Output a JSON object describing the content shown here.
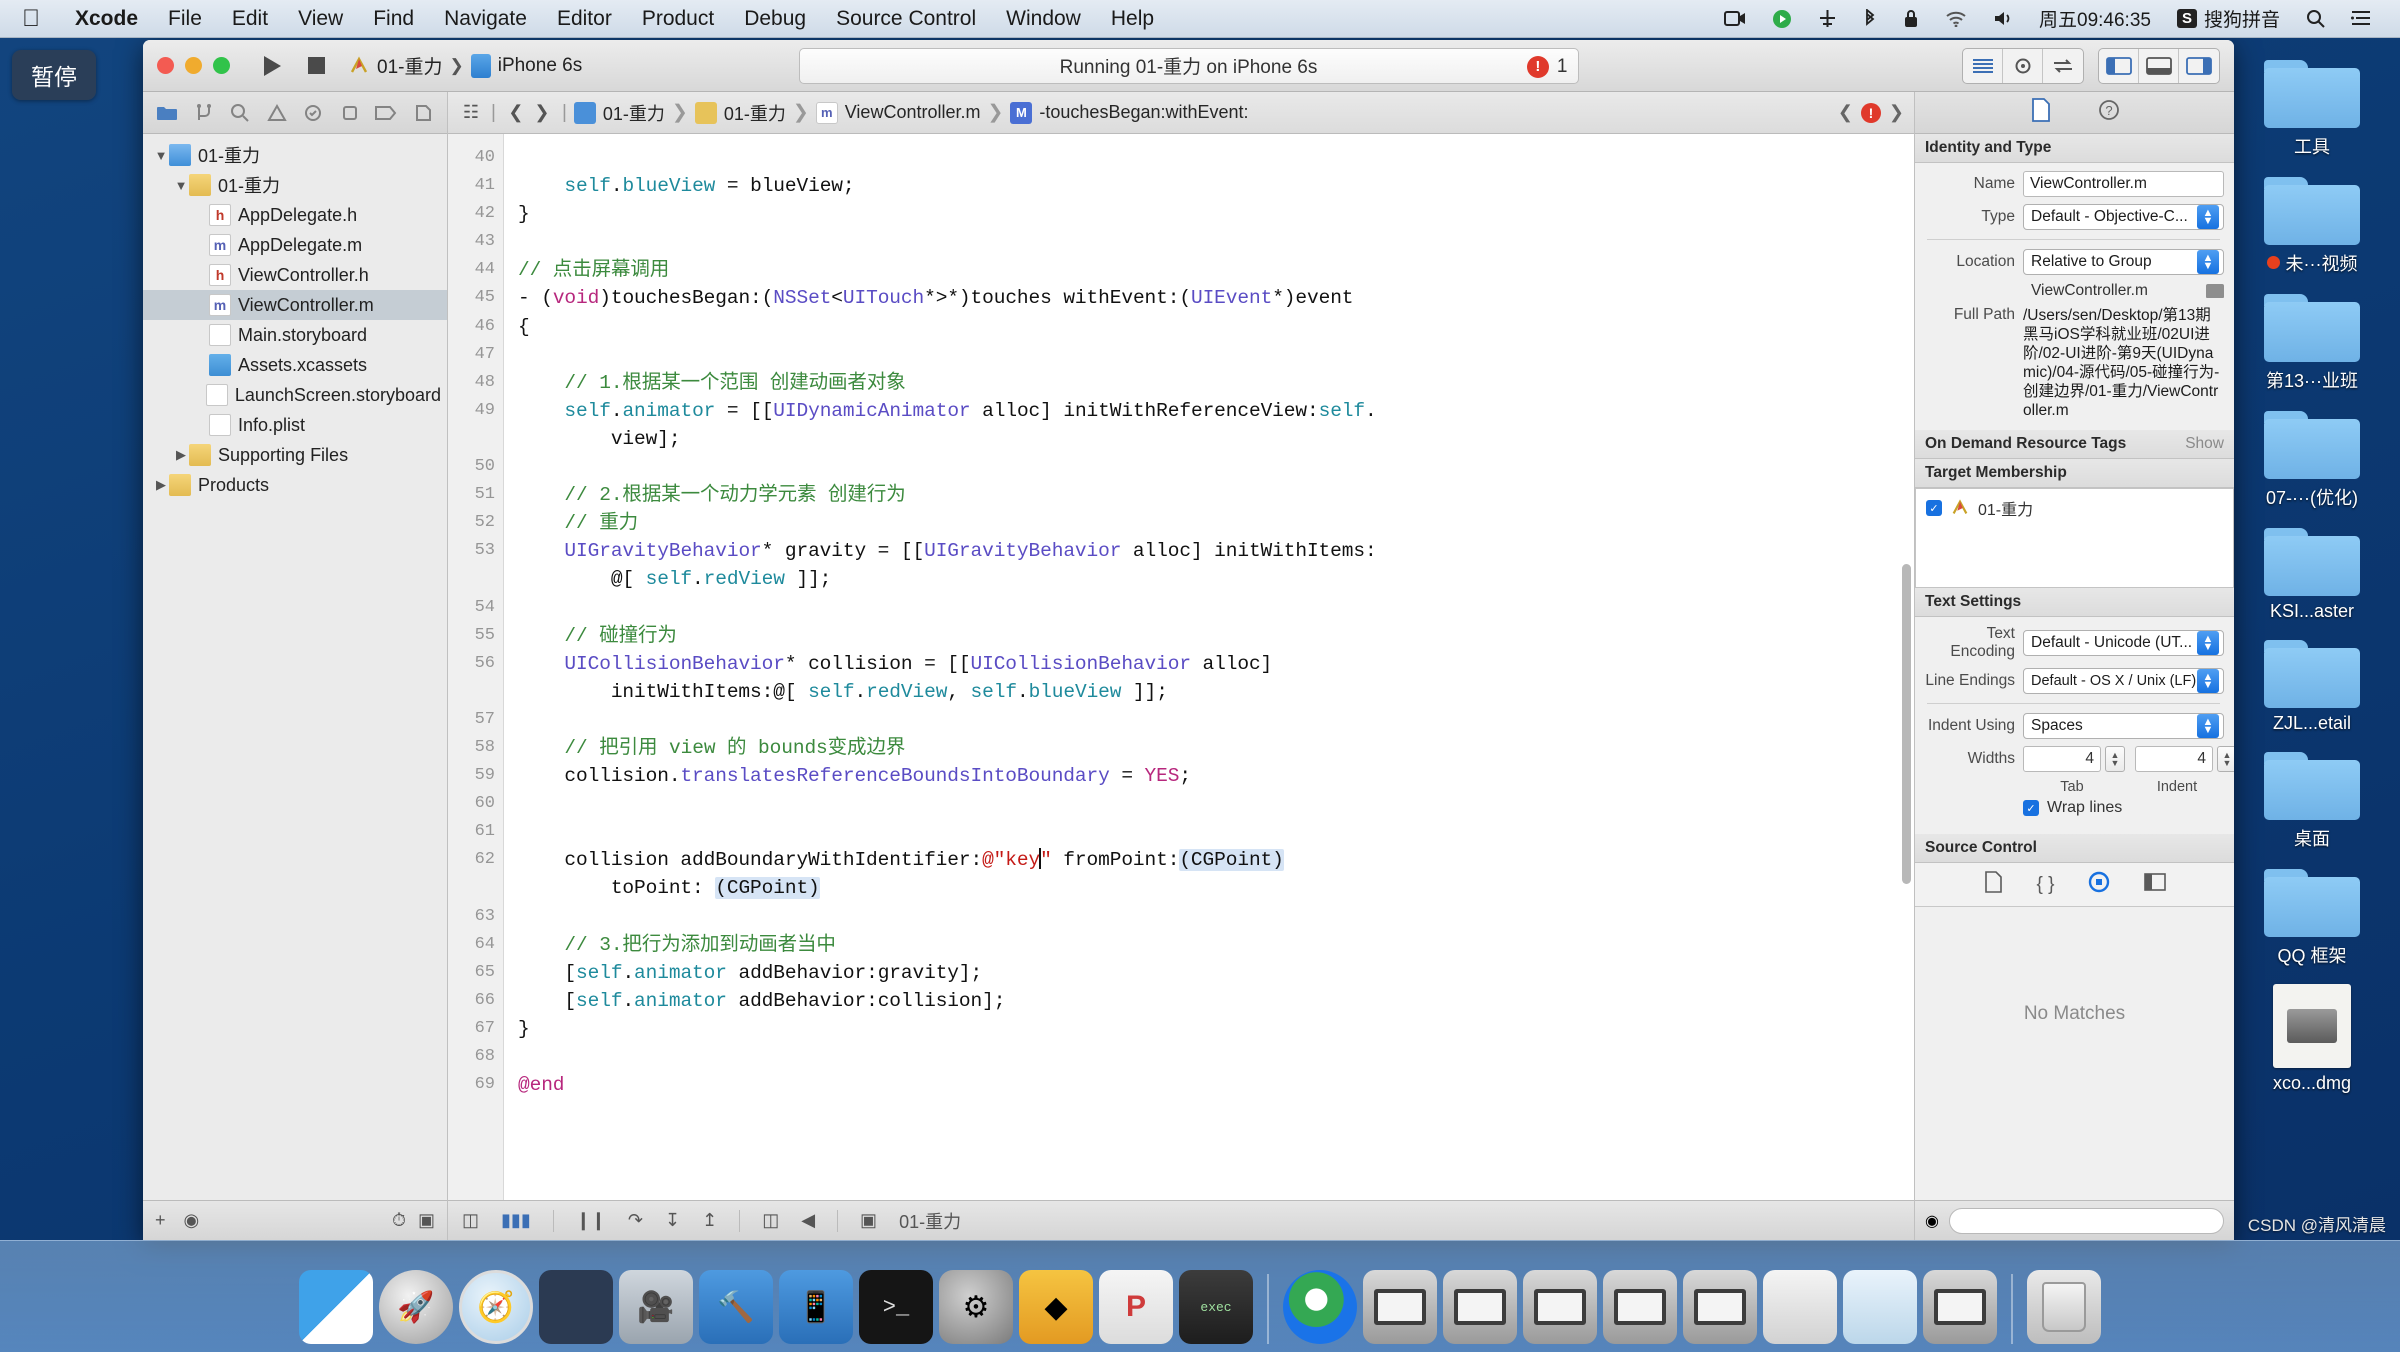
{
  "menubar": {
    "apple_icon": "apple-icon",
    "items": [
      {
        "label": "Xcode",
        "bold": true
      },
      {
        "label": "File",
        "bold": false
      },
      {
        "label": "Edit",
        "bold": false
      },
      {
        "label": "View",
        "bold": false
      },
      {
        "label": "Find",
        "bold": false
      },
      {
        "label": "Navigate",
        "bold": false
      },
      {
        "label": "Editor",
        "bold": false
      },
      {
        "label": "Product",
        "bold": false
      },
      {
        "label": "Debug",
        "bold": false
      },
      {
        "label": "Source Control",
        "bold": false
      },
      {
        "label": "Window",
        "bold": false
      },
      {
        "label": "Help",
        "bold": false
      }
    ],
    "status_items": [
      "screen-record-icon",
      "play-circle-icon",
      "airplane-icon",
      "bluetooth-icon",
      "lock-icon",
      "wifi-icon",
      "volume-icon"
    ],
    "clock": "周五09:46:35",
    "input_method_badge": "S",
    "input_method": "搜狗拼音",
    "search_icon": "spotlight-search-icon",
    "notification_icon": "notification-center-icon"
  },
  "pause_button": {
    "label": "暂停"
  },
  "desktop_icons": [
    {
      "name": "工具",
      "type": "folder",
      "partial": true
    },
    {
      "name": "未···视频",
      "type": "folder",
      "dot": true
    },
    {
      "name": "第13···业班",
      "type": "folder"
    },
    {
      "name": "07-···(优化)",
      "type": "folder"
    },
    {
      "name": "KSI...aster",
      "type": "folder"
    },
    {
      "name": "ZJL...etail",
      "type": "folder"
    },
    {
      "name": "桌面",
      "type": "folder"
    },
    {
      "name": "QQ 框架",
      "type": "folder"
    },
    {
      "name": "xco...dmg",
      "type": "dmg"
    }
  ],
  "xcode": {
    "toolbar": {
      "run_icon": "run-play-icon",
      "stop_icon": "stop-square-icon",
      "scheme_icon": "scheme-icon",
      "scheme_name": "01-重力",
      "destination_icon": "device-icon",
      "destination_name": "iPhone 6s",
      "status_text": "Running 01-重力 on iPhone 6s",
      "issue_count": "1",
      "issue_icon": "error-badge-icon",
      "right_buttons": [
        "list-view-icon",
        "assistant-editor-icon",
        "version-editor-icon",
        "hide-navigator-icon",
        "hide-debug-icon",
        "hide-utilities-icon"
      ]
    },
    "navigator": {
      "tabs": [
        "folder-icon",
        "source-control-icon",
        "search-icon",
        "warning-icon",
        "test-icon",
        "debug-icon",
        "breakpoint-icon",
        "report-icon"
      ],
      "active_tab_index": 0,
      "tree": [
        {
          "label": "01-重力",
          "indent": 0,
          "icon": "proj",
          "iconText": "",
          "twisty": "down",
          "selected": false
        },
        {
          "label": "01-重力",
          "indent": 1,
          "icon": "folder",
          "iconText": "",
          "twisty": "down",
          "selected": false
        },
        {
          "label": "AppDelegate.h",
          "indent": 2,
          "icon": "h",
          "iconText": "h",
          "twisty": "none",
          "selected": false
        },
        {
          "label": "AppDelegate.m",
          "indent": 2,
          "icon": "m",
          "iconText": "m",
          "twisty": "none",
          "selected": false
        },
        {
          "label": "ViewController.h",
          "indent": 2,
          "icon": "h",
          "iconText": "h",
          "twisty": "none",
          "selected": false
        },
        {
          "label": "ViewController.m",
          "indent": 2,
          "icon": "m",
          "iconText": "m",
          "twisty": "none",
          "selected": true
        },
        {
          "label": "Main.storyboard",
          "indent": 2,
          "icon": "sb",
          "iconText": "",
          "twisty": "none",
          "selected": false
        },
        {
          "label": "Assets.xcassets",
          "indent": 2,
          "icon": "xc",
          "iconText": "",
          "twisty": "none",
          "selected": false
        },
        {
          "label": "LaunchScreen.storyboard",
          "indent": 2,
          "icon": "sb",
          "iconText": "",
          "twisty": "none",
          "selected": false
        },
        {
          "label": "Info.plist",
          "indent": 2,
          "icon": "pl",
          "iconText": "",
          "twisty": "none",
          "selected": false
        },
        {
          "label": "Supporting Files",
          "indent": 1,
          "icon": "folder",
          "iconText": "",
          "twisty": "right",
          "selected": false
        },
        {
          "label": "Products",
          "indent": 0,
          "icon": "folder",
          "iconText": "",
          "twisty": "right",
          "selected": false
        }
      ],
      "footer_add_icon": "add-plus-icon",
      "footer_filter_icon": "filter-icon",
      "footer_recent_icon": "recent-clock-icon",
      "footer_sourcecontrol_icon": "source-control-filter-icon"
    },
    "jumpbar": {
      "grid_icon": "related-items-icon",
      "back_icon": "chevron-left-icon",
      "forward_icon": "chevron-right-icon",
      "crumbs": [
        {
          "label": "01-重力",
          "badge": "proj"
        },
        {
          "label": "01-重力",
          "badge": "folder"
        },
        {
          "label": "ViewController.m",
          "badge": "m"
        },
        {
          "label": "-touchesBegan:withEvent:",
          "badge": "M"
        }
      ],
      "prev_issue_icon": "chevron-left-icon",
      "issue_icon": "error-badge-icon",
      "next_issue_icon": "chevron-right-icon"
    },
    "editor": {
      "first_line_number": 40,
      "lines": [
        {
          "n": 40,
          "html": ""
        },
        {
          "n": 41,
          "html": "    <span class='pr'>self</span>.<span class='pr'>blueView</span> = blueView;"
        },
        {
          "n": 42,
          "html": "}"
        },
        {
          "n": 43,
          "html": ""
        },
        {
          "n": 44,
          "html": "<span class='cm'>// 点击屏幕调用</span>"
        },
        {
          "n": 45,
          "html": "- (<span class='kw'>void</span>)touchesBegan:(<span class='ty'>NSSet</span>&lt;<span class='ty'>UITouch</span>*&gt;*)touches withEvent:(<span class='ty'>UIEvent</span>*)event"
        },
        {
          "n": 46,
          "html": "{"
        },
        {
          "n": 47,
          "html": ""
        },
        {
          "n": 48,
          "html": "    <span class='cm'>// 1.根据某一个范围 创建动画者对象</span>"
        },
        {
          "n": 49,
          "html": "    <span class='pr'>self</span>.<span class='pr'>animator</span> = [[<span class='ty'>UIDynamicAnimator</span> alloc] initWithReferenceView:<span class='pr'>self</span>."
        },
        {
          "n": "",
          "html": "        view];"
        },
        {
          "n": 50,
          "html": ""
        },
        {
          "n": 51,
          "html": "    <span class='cm'>// 2.根据某一个动力学元素 创建行为</span>"
        },
        {
          "n": 52,
          "html": "    <span class='cm'>// 重力</span>"
        },
        {
          "n": 53,
          "html": "    <span class='ty'>UIGravityBehavior</span>* gravity = [[<span class='ty'>UIGravityBehavior</span> alloc] initWithItems:"
        },
        {
          "n": "",
          "html": "        @[ <span class='pr'>self</span>.<span class='pr'>redView</span> ]];"
        },
        {
          "n": 54,
          "html": ""
        },
        {
          "n": 55,
          "html": "    <span class='cm'>// 碰撞行为</span>"
        },
        {
          "n": 56,
          "html": "    <span class='ty'>UICollisionBehavior</span>* collision = [[<span class='ty'>UICollisionBehavior</span> alloc]"
        },
        {
          "n": "",
          "html": "        initWithItems:@[ <span class='pr'>self</span>.<span class='pr'>redView</span>, <span class='pr'>self</span>.<span class='pr'>blueView</span> ]];"
        },
        {
          "n": 57,
          "html": ""
        },
        {
          "n": 58,
          "html": "    <span class='cm'>// 把引用 view 的 bounds变成边界</span>"
        },
        {
          "n": 59,
          "html": "    collision.<span class='ty'>translatesReferenceBoundsIntoBoundary</span> = <span class='kw'>YES</span>;"
        },
        {
          "n": 60,
          "html": ""
        },
        {
          "n": 61,
          "html": ""
        },
        {
          "n": 62,
          "html": "    collision addBoundaryWithIdentifier:<span class='str'>@\"key</span><span class='caret'></span><span class='str'>\"</span> fromPoint:<span class='sel-ph'>(CGPoint)</span>"
        },
        {
          "n": "",
          "html": "        toPoint: <span class='sel-ph'>(CGPoint)</span>"
        },
        {
          "n": 63,
          "html": ""
        },
        {
          "n": 64,
          "html": "    <span class='cm'>// 3.把行为添加到动画者当中</span>"
        },
        {
          "n": 65,
          "html": "    [<span class='pr'>self</span>.<span class='pr'>animator</span> addBehavior:gravity];"
        },
        {
          "n": 66,
          "html": "    [<span class='pr'>self</span>.<span class='pr'>animator</span> addBehavior:collision];"
        },
        {
          "n": 67,
          "html": "}"
        },
        {
          "n": 68,
          "html": ""
        },
        {
          "n": 69,
          "html": "<span class='kw'>@end</span>"
        }
      ],
      "breakpoint_line": 62,
      "bottom_bar_icons": [
        "show-debug-area-icon",
        "folder-breakpoint-icon",
        "pause-icon",
        "step-over-icon",
        "step-into-icon",
        "step-out-icon",
        "view-hierarchy-icon",
        "location-icon",
        "process-icon"
      ],
      "bottom_process_label": "01-重力"
    },
    "inspector": {
      "tabs": [
        "file-inspector-icon",
        "quick-help-icon"
      ],
      "identity_section": "Identity and Type",
      "name_label": "Name",
      "name_value": "ViewController.m",
      "type_label": "Type",
      "type_value": "Default - Objective-C...",
      "location_label": "Location",
      "location_value": "Relative to Group",
      "file_name": "ViewController.m",
      "fullpath_label": "Full Path",
      "fullpath_value": "/Users/sen/Desktop/第13期黑马iOS学科就业班/02UI进阶/02-UI进阶-第9天(UIDynamic)/04-源代码/05-碰撞行为-创建边界/01-重力/ViewController.m",
      "ondemand_section": "On Demand Resource Tags",
      "ondemand_show": "Show",
      "target_section": "Target Membership",
      "target_item": "01-重力",
      "text_settings_section": "Text Settings",
      "encoding_label": "Text Encoding",
      "encoding_value": "Default - Unicode (UT...",
      "lineendings_label": "Line Endings",
      "lineendings_value": "Default - OS X / Unix (LF)",
      "indent_label": "Indent Using",
      "indent_value": "Spaces",
      "widths_label": "Widths",
      "tab_width": "4",
      "indent_width": "4",
      "tab_sub": "Tab",
      "indent_sub": "Indent",
      "wrap_label": "Wrap lines",
      "source_control_section": "Source Control",
      "quickhelp_icons": [
        "file-doc-icon",
        "braces-icon",
        "target-circle-icon",
        "split-panel-icon"
      ],
      "quickhelp_active_index": 2,
      "no_matches": "No Matches",
      "footer_filter_icon": "filter-icon",
      "footer_search_placeholder": ""
    }
  },
  "dock": {
    "items": [
      {
        "name": "Finder",
        "cls": "dk-finder",
        "glyph": "",
        "running": true
      },
      {
        "name": "Launchpad",
        "cls": "dk-launch",
        "glyph": "🚀",
        "running": false
      },
      {
        "name": "Safari",
        "cls": "dk-safari",
        "glyph": "🧭",
        "running": true
      },
      {
        "name": "Mouse App",
        "cls": "dk-mouse",
        "glyph": "",
        "running": true
      },
      {
        "name": "QuickTime Player",
        "cls": "dk-qt",
        "glyph": "🎥",
        "running": true
      },
      {
        "name": "Xcode",
        "cls": "dk-xcode",
        "glyph": "🔨",
        "running": true
      },
      {
        "name": "Xcode Beta",
        "cls": "dk-xcode",
        "glyph": "📱",
        "running": false
      },
      {
        "name": "Terminal",
        "cls": "dk-term",
        "glyph": ">_",
        "running": false
      },
      {
        "name": "System Preferences",
        "cls": "dk-sysprefs",
        "glyph": "⚙",
        "running": false
      },
      {
        "name": "Sketch",
        "cls": "dk-sketch",
        "glyph": "◆",
        "running": false
      },
      {
        "name": "PyCharm",
        "cls": "dk-pcharm",
        "glyph": "P",
        "running": false
      },
      {
        "name": "exec",
        "cls": "dk-exec",
        "glyph": "exec",
        "running": false
      }
    ],
    "minimized": [
      {
        "name": "Chrome window",
        "cls": "dk-chrome",
        "glyph": ""
      },
      {
        "name": "Screen Sharing 1",
        "cls": "dk-screen",
        "glyph": ""
      },
      {
        "name": "Screen Sharing 2",
        "cls": "dk-screen",
        "glyph": ""
      },
      {
        "name": "Screen Sharing 3",
        "cls": "dk-screen",
        "glyph": ""
      },
      {
        "name": "Screen Sharing 4",
        "cls": "dk-screen",
        "glyph": ""
      },
      {
        "name": "Screen Sharing 5",
        "cls": "dk-screen",
        "glyph": ""
      },
      {
        "name": "Preview document",
        "cls": "dk-pvw",
        "glyph": ""
      },
      {
        "name": "Safari page",
        "cls": "dk-ps",
        "glyph": ""
      },
      {
        "name": "Screen Sharing 6",
        "cls": "dk-screen",
        "glyph": ""
      }
    ],
    "trash": {
      "name": "Trash"
    }
  },
  "watermark": "CSDN @清风清晨"
}
